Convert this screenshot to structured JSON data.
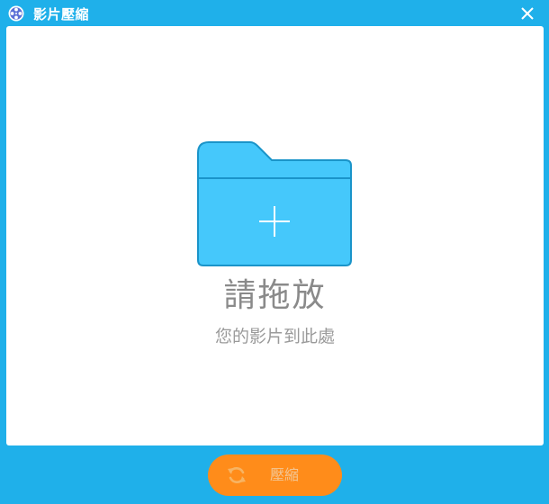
{
  "window": {
    "title": "影片壓縮"
  },
  "dropzone": {
    "title": "請拖放",
    "subtitle": "您的影片到此處"
  },
  "footer": {
    "compress_label": "壓縮"
  },
  "icons": {
    "app": "film-reel-icon",
    "close": "close-icon",
    "folder": "folder-add-icon",
    "compress": "refresh-icon"
  },
  "colors": {
    "frame": "#1fb0ea",
    "folder_fill": "#45c8fb",
    "folder_stroke": "#1a94c9",
    "button": "#ff8c1a",
    "button_text": "#f3c694",
    "text_primary": "#8a8a8a",
    "text_secondary": "#9a9a9a"
  }
}
